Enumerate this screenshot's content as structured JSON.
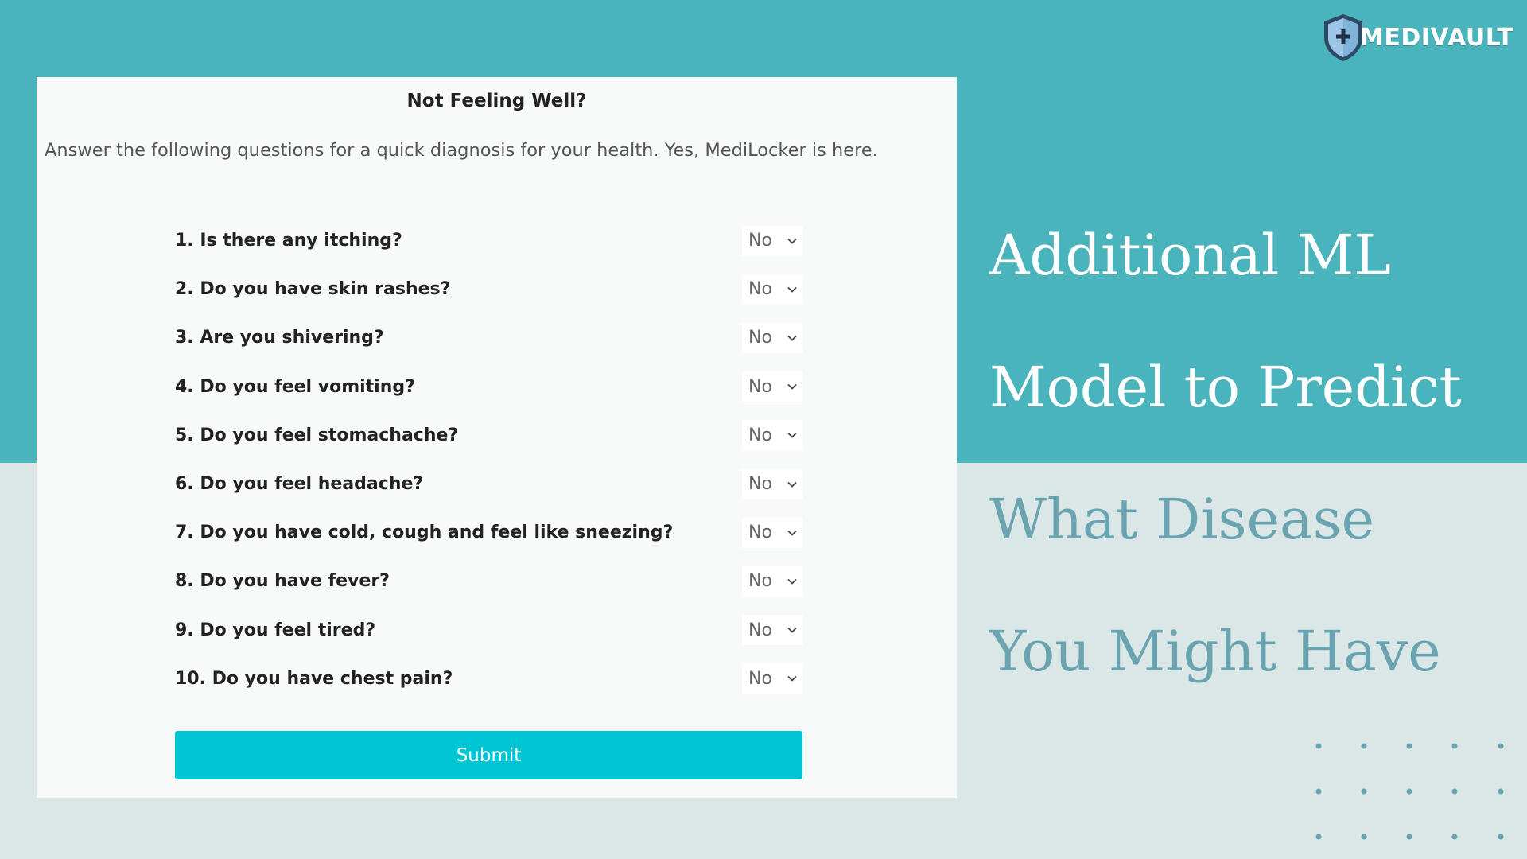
{
  "brand": {
    "name": "MEDIVAULT",
    "logo_icon": "shield-plus-icon"
  },
  "form": {
    "title": "Not Feeling Well?",
    "subtitle": "Answer the following questions for a quick diagnosis for your health. Yes, MediLocker is here.",
    "questions": [
      {
        "label": "1. Is there any itching?",
        "value": "No"
      },
      {
        "label": "2. Do you have skin rashes?",
        "value": "No"
      },
      {
        "label": "3. Are you shivering?",
        "value": "No"
      },
      {
        "label": "4. Do you feel vomiting?",
        "value": "No"
      },
      {
        "label": "5. Do you feel stomachache?",
        "value": "No"
      },
      {
        "label": "6. Do you feel headache?",
        "value": "No"
      },
      {
        "label": "7. Do you have cold, cough and feel like sneezing?",
        "value": "No"
      },
      {
        "label": "8. Do you have fever?",
        "value": "No"
      },
      {
        "label": "9. Do you feel tired?",
        "value": "No"
      },
      {
        "label": "10. Do you have chest pain?",
        "value": "No"
      }
    ],
    "submit_label": "Submit"
  },
  "headline": {
    "line1": "Additional ML",
    "line2": "Model to Predict",
    "line3": "What Disease",
    "line4": "You Might Have"
  },
  "colors": {
    "teal_band": "#4ab4bd",
    "background": "#dbe7e7",
    "submit_button": "#00c6d3",
    "headline_muted": "#6aa4b0"
  }
}
